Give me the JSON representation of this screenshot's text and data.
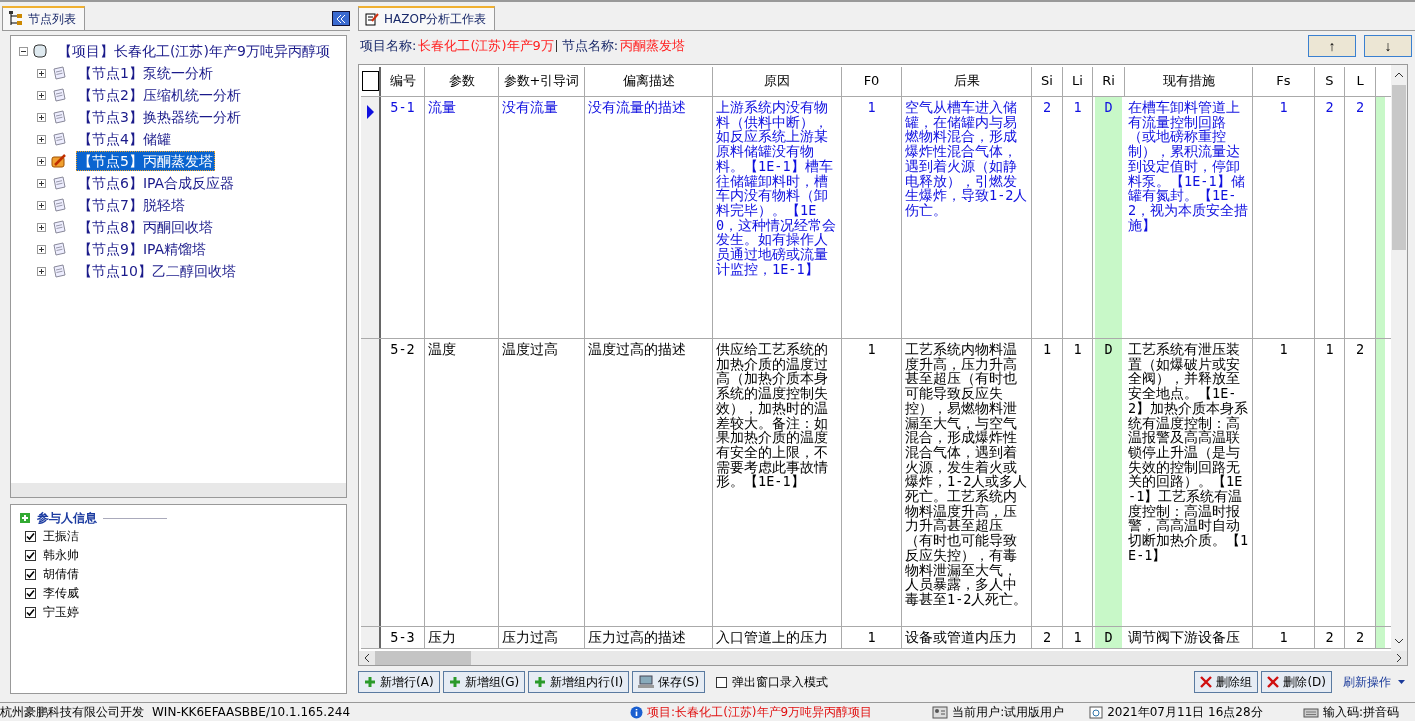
{
  "left_panel": {
    "tab": "节点列表",
    "tree": [
      {
        "label": "【项目】长春化工(江苏)年产9万吨异丙醇项",
        "expanded": true,
        "selected": false,
        "children": [
          {
            "label": "【节点1】泵统一分析",
            "expanded": false,
            "selected": false
          },
          {
            "label": "【节点2】压缩机统一分析",
            "expanded": false,
            "selected": false
          },
          {
            "label": "【节点3】换热器统一分析",
            "expanded": false,
            "selected": false
          },
          {
            "label": "【节点4】储罐",
            "expanded": false,
            "selected": false
          },
          {
            "label": "【节点5】丙酮蒸发塔",
            "expanded": false,
            "selected": true
          },
          {
            "label": "【节点6】IPA合成反应器",
            "expanded": false,
            "selected": false
          },
          {
            "label": "【节点7】脱轻塔",
            "expanded": false,
            "selected": false
          },
          {
            "label": "【节点8】丙酮回收塔",
            "expanded": false,
            "selected": false
          },
          {
            "label": "【节点9】IPA精馏塔",
            "expanded": false,
            "selected": false
          },
          {
            "label": "【节点10】乙二醇回收塔",
            "expanded": false,
            "selected": false
          }
        ]
      }
    ],
    "participants": {
      "title": "参与人信息",
      "people": [
        {
          "name": "王振洁",
          "checked": true
        },
        {
          "name": "韩永帅",
          "checked": true
        },
        {
          "name": "胡倩倩",
          "checked": true
        },
        {
          "name": "李传威",
          "checked": true
        },
        {
          "name": "宁玉婷",
          "checked": true
        }
      ]
    }
  },
  "worksheet": {
    "tab": "HAZOP分析工作表",
    "project_label": "项目名称:",
    "project_value": "长春化工(江苏)年产9万",
    "node_label": "节点名称:",
    "node_value": "丙酮蒸发塔",
    "nav_buttons": [
      "↑",
      "↓"
    ],
    "table": {
      "columns": [
        {
          "label": "编号",
          "kind": "code"
        },
        {
          "label": "参数",
          "kind": "text"
        },
        {
          "label": "参数+引导词",
          "kind": "text"
        },
        {
          "label": "偏离描述",
          "kind": "text"
        },
        {
          "label": "原因",
          "kind": "text"
        },
        {
          "label": "F0",
          "kind": "number"
        },
        {
          "label": "后果",
          "kind": "text"
        },
        {
          "label": "Si",
          "kind": "number"
        },
        {
          "label": "Li",
          "kind": "number"
        },
        {
          "label": "Ri",
          "kind": "rating"
        },
        {
          "label": "现有措施",
          "kind": "text"
        },
        {
          "label": "Fs",
          "kind": "number"
        },
        {
          "label": "S",
          "kind": "number"
        },
        {
          "label": "L",
          "kind": "number"
        }
      ],
      "rows": [
        {
          "current": true,
          "cells": [
            "5-1",
            "流量",
            "没有流量",
            "没有流量的描述",
            "上游系统内没有物料（供料中断），如反应系统上游某原料储罐没有物料。【1E-1】槽车往储罐卸料时，槽车内没有物料（卸料完毕）。【1E0，这种情况经常会发生。如有操作人员通过地磅或流量计监控，1E-1】",
            "1",
            "空气从槽车进入储罐，在储罐内与易燃物料混合，形成爆炸性混合气体，遇到着火源（如静电释放），引燃发生爆炸，导致1-2人伤亡。",
            "2",
            "1",
            "D",
            "在槽车卸料管道上有流量控制回路（或地磅称重控制），累积流量达到设定值时，停卸料泵。【1E-1】储罐有氮封。【1E-2，视为本质安全措施】",
            "1",
            "2",
            "2"
          ]
        },
        {
          "current": false,
          "cells": [
            "5-2",
            "温度",
            "温度过高",
            "温度过高的描述",
            "供应给工艺系统的加热介质的温度过高（加热介质本身系统的温度控制失效），加热时的温差较大。备注：如果加热介质的温度有安全的上限，不需要考虑此事故情形。【1E-1】",
            "1",
            "工艺系统内物料温度升高，压力升高甚至超压（有时也可能导致反应失控），易燃物料泄漏至大气，与空气混合，形成爆炸性混合气体，遇到着火源，发生着火或爆炸，1-2人或多人死亡。工艺系统内物料温度升高，压力升高甚至超压（有时也可能导致反应失控），有毒物料泄漏至大气，人员暴露，多人中毒甚至1-2人死亡。",
            "1",
            "1",
            "D",
            "工艺系统有泄压装置（如爆破片或安全阀），并释放至安全地点。【1E-2】加热介质本身系统有温度控制：高温报警及高高温联锁停止升温（是与失效的控制回路无关的回路）。【1E-1】工艺系统有温度控制：高温时报警，高高温时自动切断加热介质。【1E-1】",
            "1",
            "1",
            "2"
          ]
        },
        {
          "current": false,
          "cells": [
            "5-3",
            "压力",
            "压力过高",
            "压力过高的描述",
            "入口管道上的压力",
            "1",
            "设备或管道内压力",
            "2",
            "1",
            "D",
            "调节阀下游设备压",
            "1",
            "2",
            "2"
          ]
        }
      ]
    },
    "buttons_left": [
      {
        "label": "新增行(A)",
        "kind": "add"
      },
      {
        "label": "新增组(G)",
        "kind": "add"
      },
      {
        "label": "新增组内行(I)",
        "kind": "add"
      },
      {
        "label": "保存(S)",
        "kind": "save"
      }
    ],
    "popup_mode": {
      "label": "弹出窗口录入模式",
      "checked": false
    },
    "buttons_right": [
      {
        "label": "删除组",
        "kind": "delete"
      },
      {
        "label": "删除(D)",
        "kind": "delete"
      }
    ],
    "refresh_menu": "刷新操作"
  },
  "status_bar": {
    "company": "杭州豪鹏科技有限公司开发",
    "host": "WIN-KK6EFAASBBE/10.1.165.244",
    "project": "项目:长春化工(江苏)年产9万吨异丙醇项目",
    "user": "当前用户:试用版用户",
    "datetime": "2021年07月11日 16点28分",
    "input": "输入码:拼音码"
  }
}
